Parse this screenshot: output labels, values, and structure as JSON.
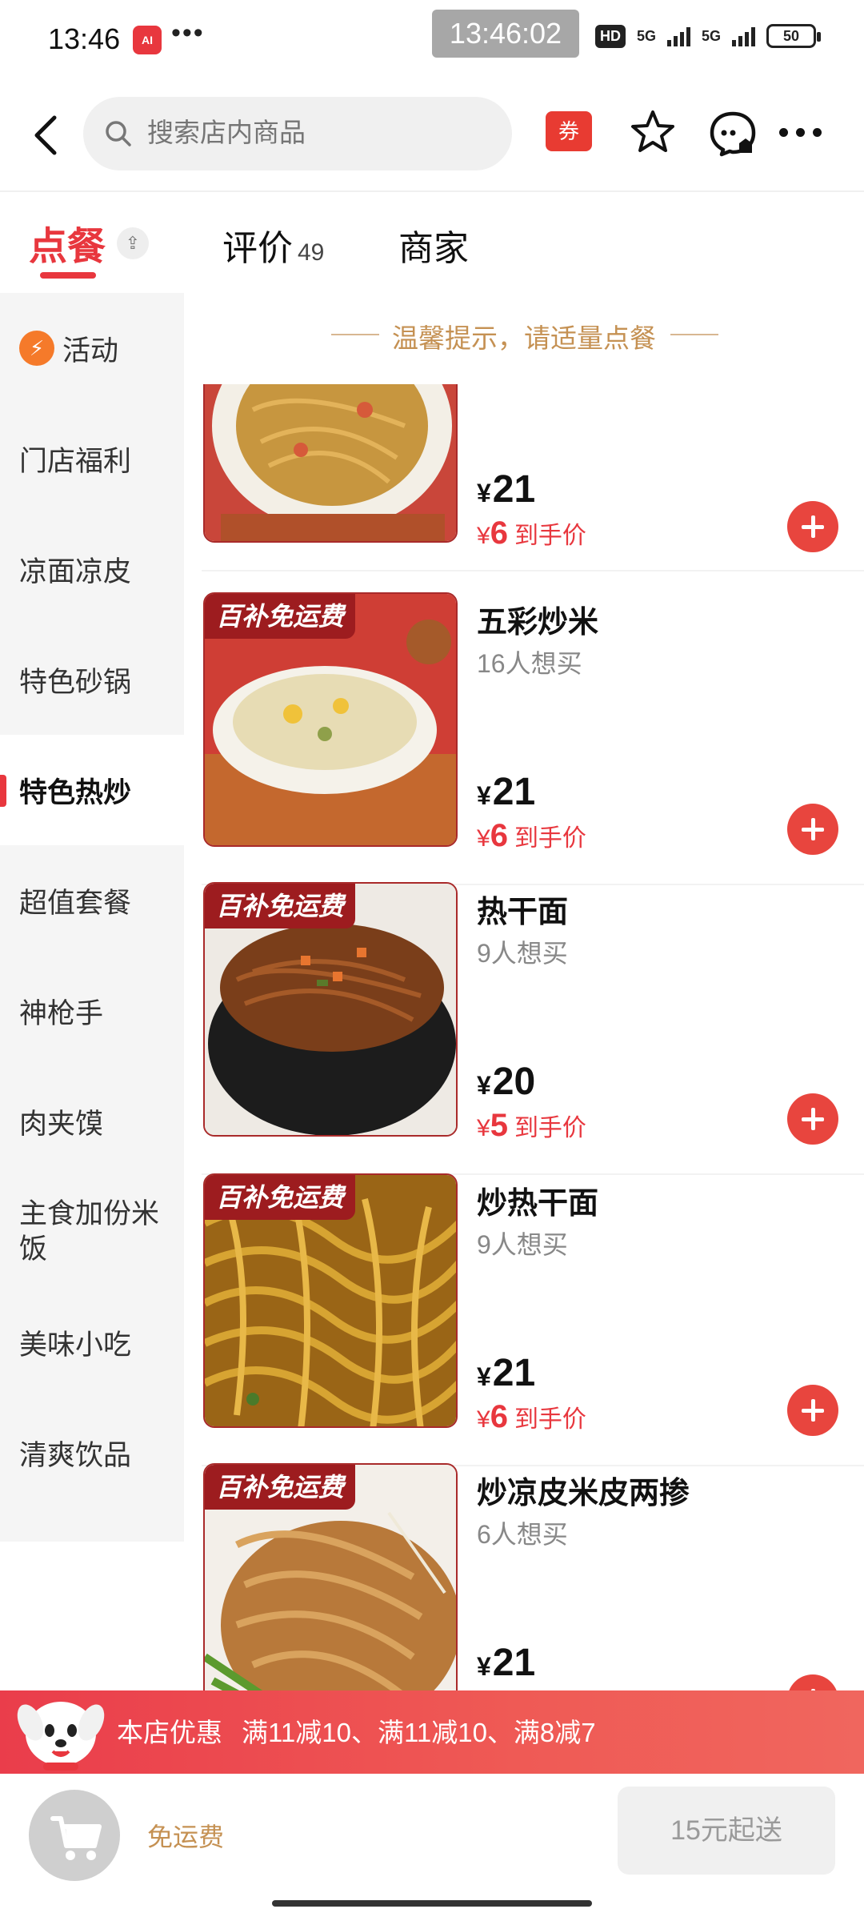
{
  "status_bar": {
    "time": "13:46",
    "app_icon_text": "AI",
    "dots": "•••",
    "clock": "13:46:02",
    "hd": "HD",
    "net1": "5G",
    "net2": "5G",
    "battery": "50"
  },
  "header": {
    "search_placeholder": "搜索店内商品",
    "coupon_label": "券"
  },
  "tabs": {
    "order": "点餐",
    "order_badge": "⇪",
    "review": "评价",
    "review_count": "49",
    "merchant": "商家"
  },
  "sidebar": {
    "items": [
      {
        "label": "活动"
      },
      {
        "label": "门店福利"
      },
      {
        "label": "凉面凉皮"
      },
      {
        "label": "特色砂锅"
      },
      {
        "label": "特色热炒"
      },
      {
        "label": "超值套餐"
      },
      {
        "label": "神枪手"
      },
      {
        "label": "肉夹馍"
      },
      {
        "label": "主食加份米饭"
      },
      {
        "label": "美味小吃"
      },
      {
        "label": "清爽饮品"
      }
    ],
    "active_index": 4,
    "activity_icon": "⚡"
  },
  "tip": "温馨提示，请适量点餐",
  "products": [
    {
      "name": "",
      "wish": "",
      "tag": "",
      "currency": "¥",
      "price": "21",
      "final_currency": "¥",
      "final_price": "6",
      "final_note": "到手价"
    },
    {
      "name": "五彩炒米",
      "wish": "16人想买",
      "tag": "百补免运费",
      "currency": "¥",
      "price": "21",
      "final_currency": "¥",
      "final_price": "6",
      "final_note": "到手价"
    },
    {
      "name": "热干面",
      "wish": "9人想买",
      "tag": "百补免运费",
      "currency": "¥",
      "price": "20",
      "final_currency": "¥",
      "final_price": "5",
      "final_note": "到手价"
    },
    {
      "name": "炒热干面",
      "wish": "9人想买",
      "tag": "百补免运费",
      "currency": "¥",
      "price": "21",
      "final_currency": "¥",
      "final_price": "6",
      "final_note": "到手价"
    },
    {
      "name": "炒凉皮米皮两掺",
      "wish": "6人想买",
      "tag": "百补免运费",
      "currency": "¥",
      "price": "21",
      "final_currency": "",
      "final_price": "",
      "final_note": ""
    }
  ],
  "promo": {
    "label": "本店优惠",
    "text": "满11减10、满11减10、满8减7"
  },
  "cart": {
    "free_shipping": "免运费",
    "min_order": "15元起送"
  },
  "colors": {
    "accent": "#e8373e",
    "gold": "#c59153"
  }
}
